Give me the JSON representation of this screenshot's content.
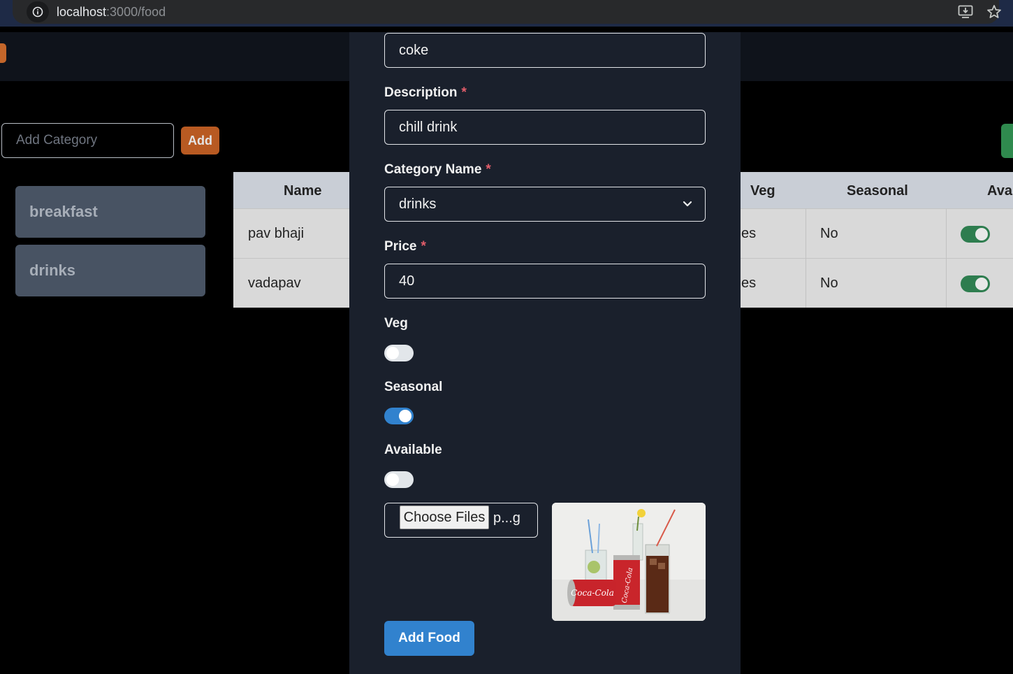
{
  "browser": {
    "url_host": "localhost",
    "url_path": ":3000/food"
  },
  "categories_panel": {
    "input_placeholder": "Add Category",
    "add_label": "Add",
    "items": [
      "breakfast",
      "drinks"
    ]
  },
  "table": {
    "headers": {
      "name": "Name",
      "veg": "Veg",
      "seasonal": "Seasonal",
      "available": "Ava"
    },
    "rows": [
      {
        "name": "pav bhaji",
        "veg": "es",
        "seasonal": "No",
        "available": true
      },
      {
        "name": "vadapav",
        "veg": "es",
        "seasonal": "No",
        "available": true
      }
    ]
  },
  "modal": {
    "name_value": "coke",
    "description_label": "Description",
    "description_value": "chill drink",
    "category_label": "Category Name",
    "category_value": "drinks",
    "price_label": "Price",
    "price_value": "40",
    "required_mark": "*",
    "veg_label": "Veg",
    "veg_on": false,
    "seasonal_label": "Seasonal",
    "seasonal_on": true,
    "available_label": "Available",
    "available_on": false,
    "choose_files_label": "Choose Files",
    "file_name": "p...g",
    "preview_image": "coca-cola-drinks-photo",
    "submit_label": "Add Food"
  },
  "colors": {
    "accent_blue": "#3182ce",
    "add_orange": "#b85a22",
    "toggle_green": "#2e7d4f",
    "modal_bg": "#1a202c",
    "required_red": "#e35d6a"
  }
}
